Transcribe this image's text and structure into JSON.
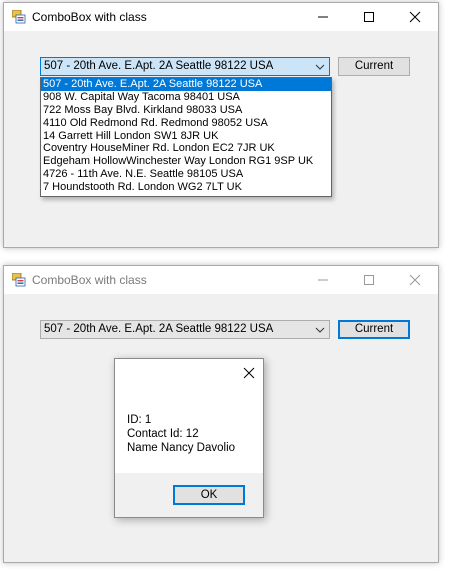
{
  "window1": {
    "title": "ComboBox with class",
    "combo_value": "507 - 20th Ave. E.Apt. 2A Seattle 98122 USA",
    "button_label": "Current",
    "dropdown_items": [
      "507 - 20th Ave. E.Apt. 2A Seattle 98122 USA",
      "908 W. Capital Way Tacoma 98401 USA",
      "722 Moss Bay Blvd. Kirkland 98033 USA",
      "4110 Old Redmond Rd. Redmond 98052 USA",
      "14 Garrett Hill London SW1 8JR UK",
      "Coventry HouseMiner Rd. London EC2 7JR UK",
      "Edgeham HollowWinchester Way London RG1 9SP UK",
      "4726 - 11th Ave. N.E. Seattle 98105 USA",
      "7 Houndstooth Rd. London WG2 7LT UK"
    ]
  },
  "window2": {
    "title": "ComboBox with class",
    "combo_value": "507 - 20th Ave. E.Apt. 2A Seattle 98122 USA",
    "button_label": "Current",
    "dialog": {
      "line1": "ID: 1",
      "line2": "Contact Id: 12",
      "line3": "Name Nancy Davolio",
      "ok_label": "OK"
    }
  },
  "colors": {
    "accent": "#0078d7",
    "window_bg": "#f0f0f0",
    "title_bg": "#ffffff"
  },
  "icons": [
    "app-icon",
    "minimize-icon",
    "maximize-icon",
    "close-icon",
    "chevron-down-icon"
  ]
}
